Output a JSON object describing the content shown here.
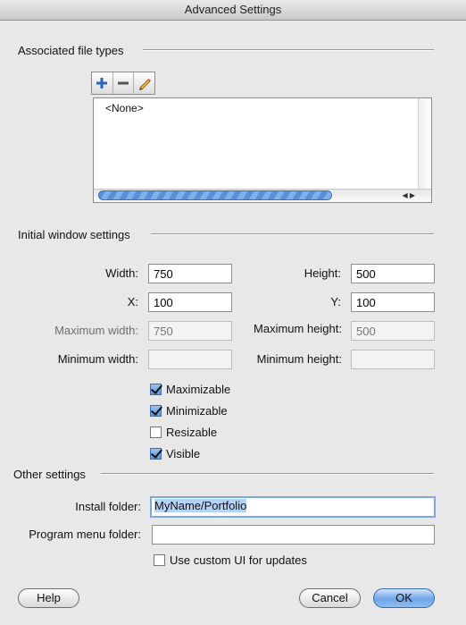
{
  "window": {
    "title": "Advanced Settings"
  },
  "sections": {
    "file_types": "Associated file types",
    "initial_window": "Initial window settings",
    "other": "Other settings"
  },
  "file_types": {
    "toolbar": {
      "add_icon": "plus-icon",
      "remove_icon": "minus-icon",
      "edit_icon": "pencil-icon"
    },
    "items": [
      "<None>"
    ]
  },
  "window_settings": {
    "width_label": "Width:",
    "width_value": "750",
    "height_label": "Height:",
    "height_value": "500",
    "x_label": "X:",
    "x_value": "100",
    "y_label": "Y:",
    "y_value": "100",
    "max_width_label": "Maximum width:",
    "max_width_placeholder": "750",
    "max_height_label": "Maximum height:",
    "max_height_placeholder": "500",
    "min_width_label": "Minimum width:",
    "min_width_value": "",
    "min_height_label": "Minimum height:",
    "min_height_value": ""
  },
  "options": [
    {
      "label": "Maximizable",
      "checked": true
    },
    {
      "label": "Minimizable",
      "checked": true
    },
    {
      "label": "Resizable",
      "checked": false
    },
    {
      "label": "Visible",
      "checked": true
    }
  ],
  "other": {
    "install_folder_label": "Install folder:",
    "install_folder_value": "MyName/Portfolio",
    "program_menu_label": "Program menu folder:",
    "program_menu_value": "",
    "custom_ui_label": "Use custom UI for updates",
    "custom_ui_checked": false
  },
  "buttons": {
    "help": "Help",
    "cancel": "Cancel",
    "ok": "OK"
  },
  "colors": {
    "accent": "#6fa6e8",
    "focus_ring": "#7aa7dc",
    "selection": "#b5d3f5"
  }
}
